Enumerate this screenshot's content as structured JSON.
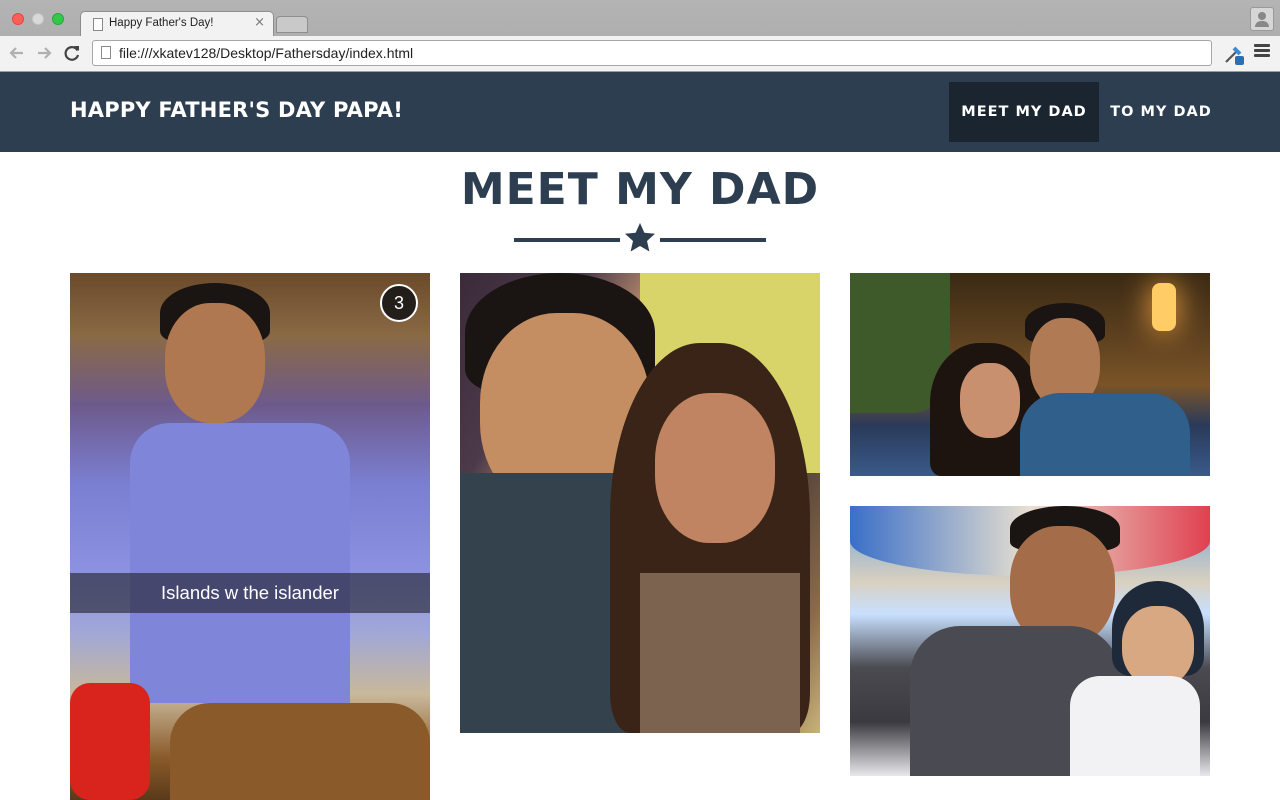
{
  "browser": {
    "tab_title": "Happy Father's Day!",
    "tab_close": "×",
    "url": "file:///xkatev128/Desktop/Fathersday/index.html"
  },
  "navbar": {
    "brand": "HAPPY FATHER'S DAY PAPA!",
    "links": [
      {
        "label": "MEET MY DAD",
        "active": true
      },
      {
        "label": "TO MY DAD",
        "active": false
      }
    ]
  },
  "section": {
    "title": "MEET MY DAD"
  },
  "photos": [
    {
      "badge": "3",
      "caption": "Islands w the islander"
    }
  ],
  "colors": {
    "navbar_bg": "#2c3e50",
    "active_link_bg": "#1a252f",
    "title_color": "#2c3e50"
  },
  "icons": [
    "back-icon",
    "forward-icon",
    "reload-icon",
    "page-icon",
    "eyedropper-extension-icon",
    "menu-icon",
    "profile-icon",
    "star-icon"
  ]
}
